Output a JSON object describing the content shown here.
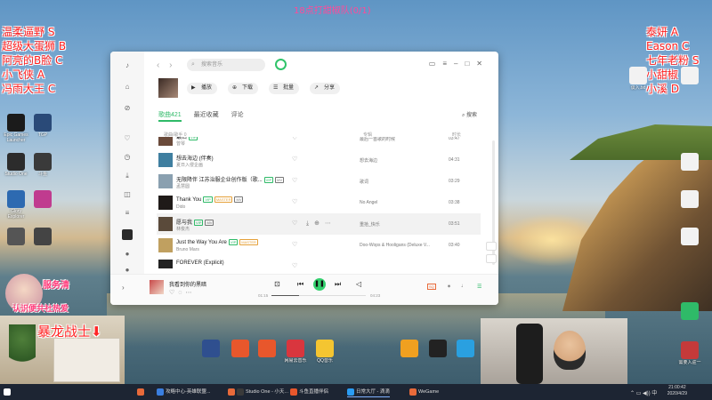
{
  "overlay": {
    "top": "18点打甜椒队(0/1)",
    "left_names": [
      "温柔逼野 S",
      "超级大蛋狮 B",
      "阿亮的B脸 C",
      "小飞侠 A",
      "冯雨大王 C"
    ],
    "right_names": [
      "泰妍 A",
      "Eason C",
      "七年老粉 S",
      "小甜椒 B",
      "小溪 D"
    ],
    "bottom": "暴龙战士⬇",
    "badge_main": "服务清",
    "badge_sub": "认识便共社热爱"
  },
  "desktop_icons": [
    {
      "label": "Epic Games Launcher",
      "color": "#1b1b1b"
    },
    {
      "label": "TGP",
      "color": "#2a4a78"
    },
    {
      "label": "Studio One",
      "color": "#2c2c2c"
    },
    {
      "label": "斗鱼",
      "color": "#3a3a3a"
    },
    {
      "label": "Glory Explorer",
      "color": "#2d6ab1"
    },
    {
      "label": "",
      "color": "#c03b8f"
    },
    {
      "label": "",
      "color": "#555555"
    },
    {
      "label": "",
      "color": "#444444"
    }
  ],
  "desktop_icons_right": [
    {
      "label": "谈入.txt",
      "color": "#f2f2f2"
    },
    {
      "label": "",
      "color": "#f2f2f2"
    },
    {
      "label": "",
      "color": "#f2f2f2"
    },
    {
      "label": "",
      "color": "#f2f2f2"
    },
    {
      "label": "",
      "color": "#f2f2f2"
    },
    {
      "label": "",
      "color": "#2fba68"
    },
    {
      "label": "需要入驻一",
      "color": "#c53a3a"
    }
  ],
  "dock_icons": [
    {
      "label": "",
      "color": "#2f4f8f"
    },
    {
      "label": "",
      "color": "#e8572c"
    },
    {
      "label": "",
      "color": "#e8572c"
    },
    {
      "label": "网易云音乐",
      "color": "#d9363e"
    },
    {
      "label": "QQ音乐",
      "color": "#f4c531"
    },
    {
      "label": "",
      "color": "#f0a020"
    },
    {
      "label": "",
      "color": "#222222"
    },
    {
      "label": "",
      "color": "#2aa0e0"
    }
  ],
  "player": {
    "search_placeholder": "搜索音乐",
    "actions": {
      "play": "播放",
      "download": "下载",
      "batch": "批量",
      "share": "分享"
    },
    "tabs": {
      "songs": "歌曲421",
      "recent": "最近收藏",
      "comments": "评论"
    },
    "tab_search": "搜索",
    "columns": {
      "title": "歌曲/歌手 0",
      "album": "专辑",
      "duration": "时长"
    },
    "songs": [
      {
        "title": "最后",
        "artist": "曾琴",
        "album": "最后一首歌的时候",
        "duration": "03:47",
        "color": "#6a4a3a",
        "tags": [
          "VIP"
        ]
      },
      {
        "title": "想去海边 (伴奏)",
        "artist": "夏日入侵企画",
        "album": "想去海边",
        "duration": "04:31",
        "color": "#3f7fa0",
        "tags": []
      },
      {
        "title": "无限降伴 江苏治服企业创作版（歌...",
        "artist": "孟慧圆",
        "album": "歌词",
        "duration": "03:29",
        "color": "#8aa0b0",
        "tags": [
          "VIP",
          "MV"
        ]
      },
      {
        "title": "Thank You",
        "artist": "Dido",
        "album": "No Angel",
        "duration": "03:38",
        "color": "#1f1a18",
        "tags": [
          "VIP",
          "MASTER",
          "MV"
        ]
      },
      {
        "title": "愿与我",
        "artist": "林俊杰",
        "album": "重拾_快乐",
        "duration": "03:51",
        "color": "#5a4a3a",
        "tags": [
          "VIP",
          "MV"
        ]
      },
      {
        "title": "Just the Way You Are",
        "artist": "Bruno Mars",
        "album": "Doo-Wops & Hooligans (Deluxe V...",
        "duration": "03:40",
        "color": "#c0a060",
        "tags": [
          "VIP",
          "MASTER"
        ]
      },
      {
        "title": "FOREVER (Explicit)",
        "artist": "",
        "album": "",
        "duration": "",
        "color": "#222222",
        "tags": []
      }
    ],
    "now_playing": "我看到你的黑暗",
    "time_current": "01:15",
    "time_total": "04:23",
    "progress": 0.29,
    "quality_badge": "SQ"
  },
  "taskbar": {
    "items": [
      {
        "label": "",
        "color": "#e86a3a"
      },
      {
        "label": "攻略中心-英雄联盟...",
        "color": "#3a7fe0"
      },
      {
        "label": "",
        "color": "#e86a3a"
      },
      {
        "label": "Studio One - 小天...",
        "color": "#3a3a3a"
      },
      {
        "label": "斗鱼直播伴侣",
        "color": "#e8572c"
      },
      {
        "label": "日常大厅 - 滴滴",
        "color": "#2a9df4"
      },
      {
        "label": "WeGame",
        "color": "#e86a3a"
      }
    ],
    "time": "21:00:42",
    "date": "2020/4/29"
  }
}
